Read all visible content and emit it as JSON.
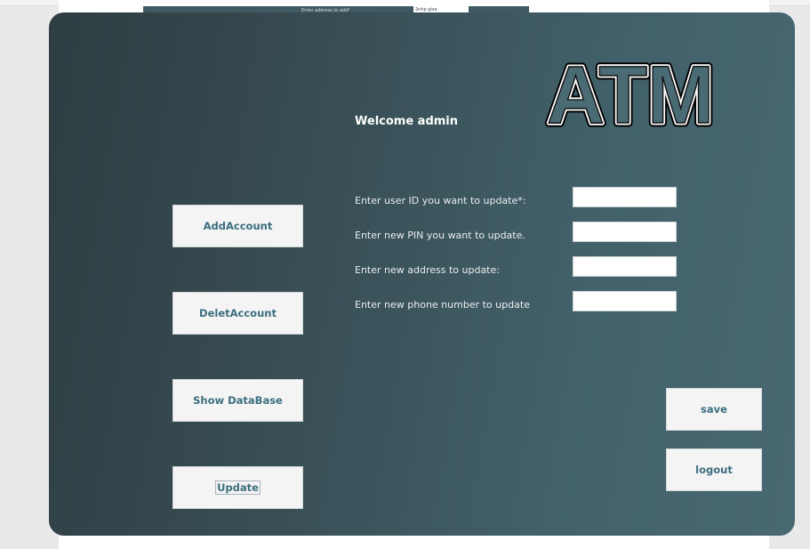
{
  "background": {
    "strip_label": "Enter address to add*",
    "strip_value": "2nhp giza"
  },
  "app": {
    "logo_text": "ATM",
    "welcome": "Welcome admin"
  },
  "sidebar": {
    "add_account": "AddAccount",
    "delete_account": "DeletAccount",
    "show_database": "Show DataBase",
    "update": "Update"
  },
  "form": {
    "user_id_label": "Enter user ID you want to update*:",
    "user_id_value": "",
    "pin_label": "Enter new PIN you want to update.",
    "pin_value": "",
    "address_label": "Enter new  address to update:",
    "address_value": "",
    "phone_label": "Enter new phone number to update",
    "phone_value": ""
  },
  "actions": {
    "save": "save",
    "logout": "logout"
  },
  "colors": {
    "panel_dark": "#2e3d42",
    "panel_light": "#486872",
    "button_bg": "#f4f4f4",
    "button_text": "#3b6e7e"
  }
}
